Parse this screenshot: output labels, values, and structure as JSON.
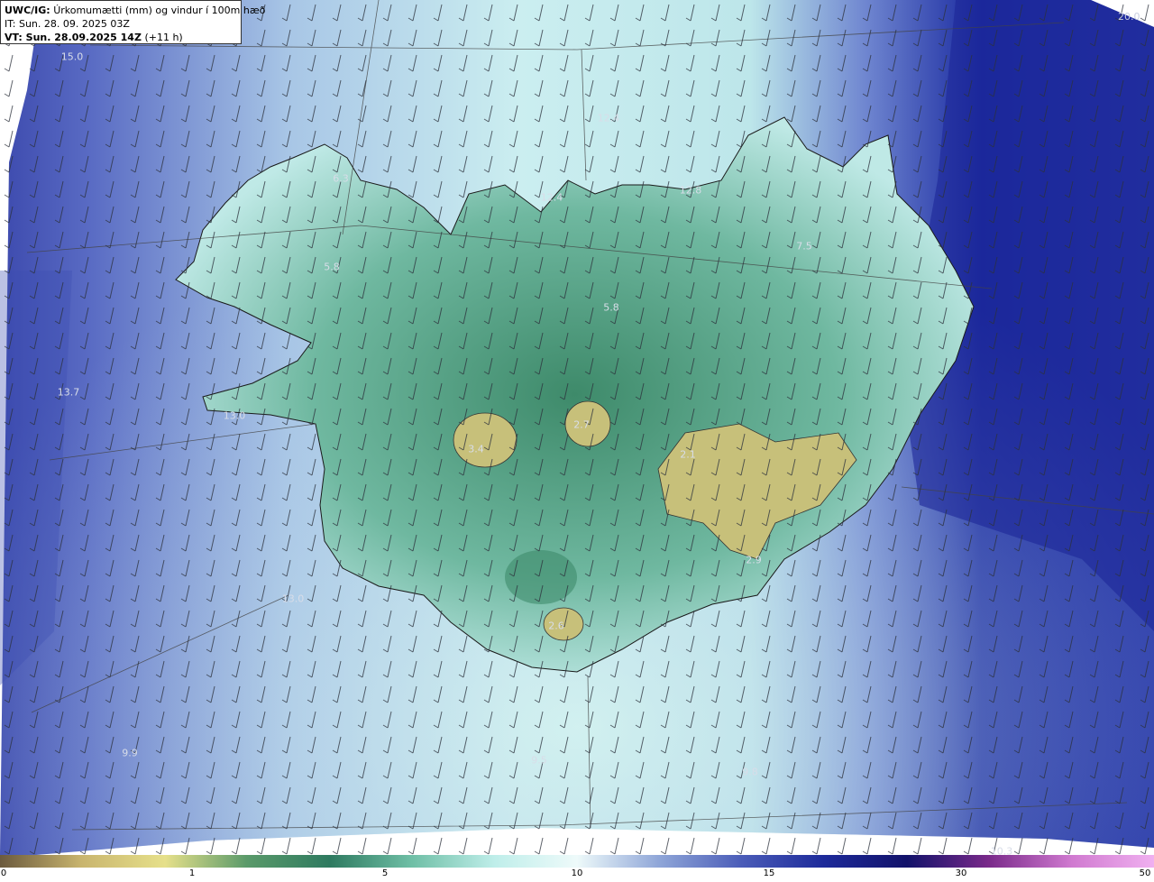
{
  "header": {
    "model": "UWC/IG:",
    "title": "Úrkomumætti (mm) og vindur í 100m hæð",
    "initial_time": "IT: Sun. 28. 09. 2025 03Z",
    "valid_time_prefix": "VT: Sun. 28.09.2025 14Z",
    "lead_time": "(+11 h)"
  },
  "map_labels": [
    {
      "text": "15.0"
    },
    {
      "text": "20.0"
    },
    {
      "text": "12.4"
    },
    {
      "text": "12.4"
    },
    {
      "text": "12.8"
    },
    {
      "text": "6.3"
    },
    {
      "text": "5.8"
    },
    {
      "text": "7.5"
    },
    {
      "text": "5.8"
    },
    {
      "text": "13.7"
    },
    {
      "text": "13.0"
    },
    {
      "text": "3.4"
    },
    {
      "text": "2.7"
    },
    {
      "text": "2.1"
    },
    {
      "text": "2.9"
    },
    {
      "text": "13.0"
    },
    {
      "text": "2.6"
    },
    {
      "text": "9.9"
    },
    {
      "text": "9.5"
    },
    {
      "text": "9.8"
    },
    {
      "text": "10.3"
    }
  ],
  "colorbar": {
    "unit": "mm",
    "ticks": [
      "0",
      "1",
      "5",
      "10",
      "15",
      "30",
      "50"
    ],
    "colors": [
      "#6b5a3e",
      "#c9b56e",
      "#e6e08a",
      "#5a9a6a",
      "#2e7a60",
      "#6fbfa6",
      "#bfeeea",
      "#eefafa",
      "#8fa6d8",
      "#4a5cb8",
      "#1d2a9a",
      "#12126a",
      "#7a2a8a",
      "#d07ad0",
      "#f0b0f0"
    ]
  }
}
